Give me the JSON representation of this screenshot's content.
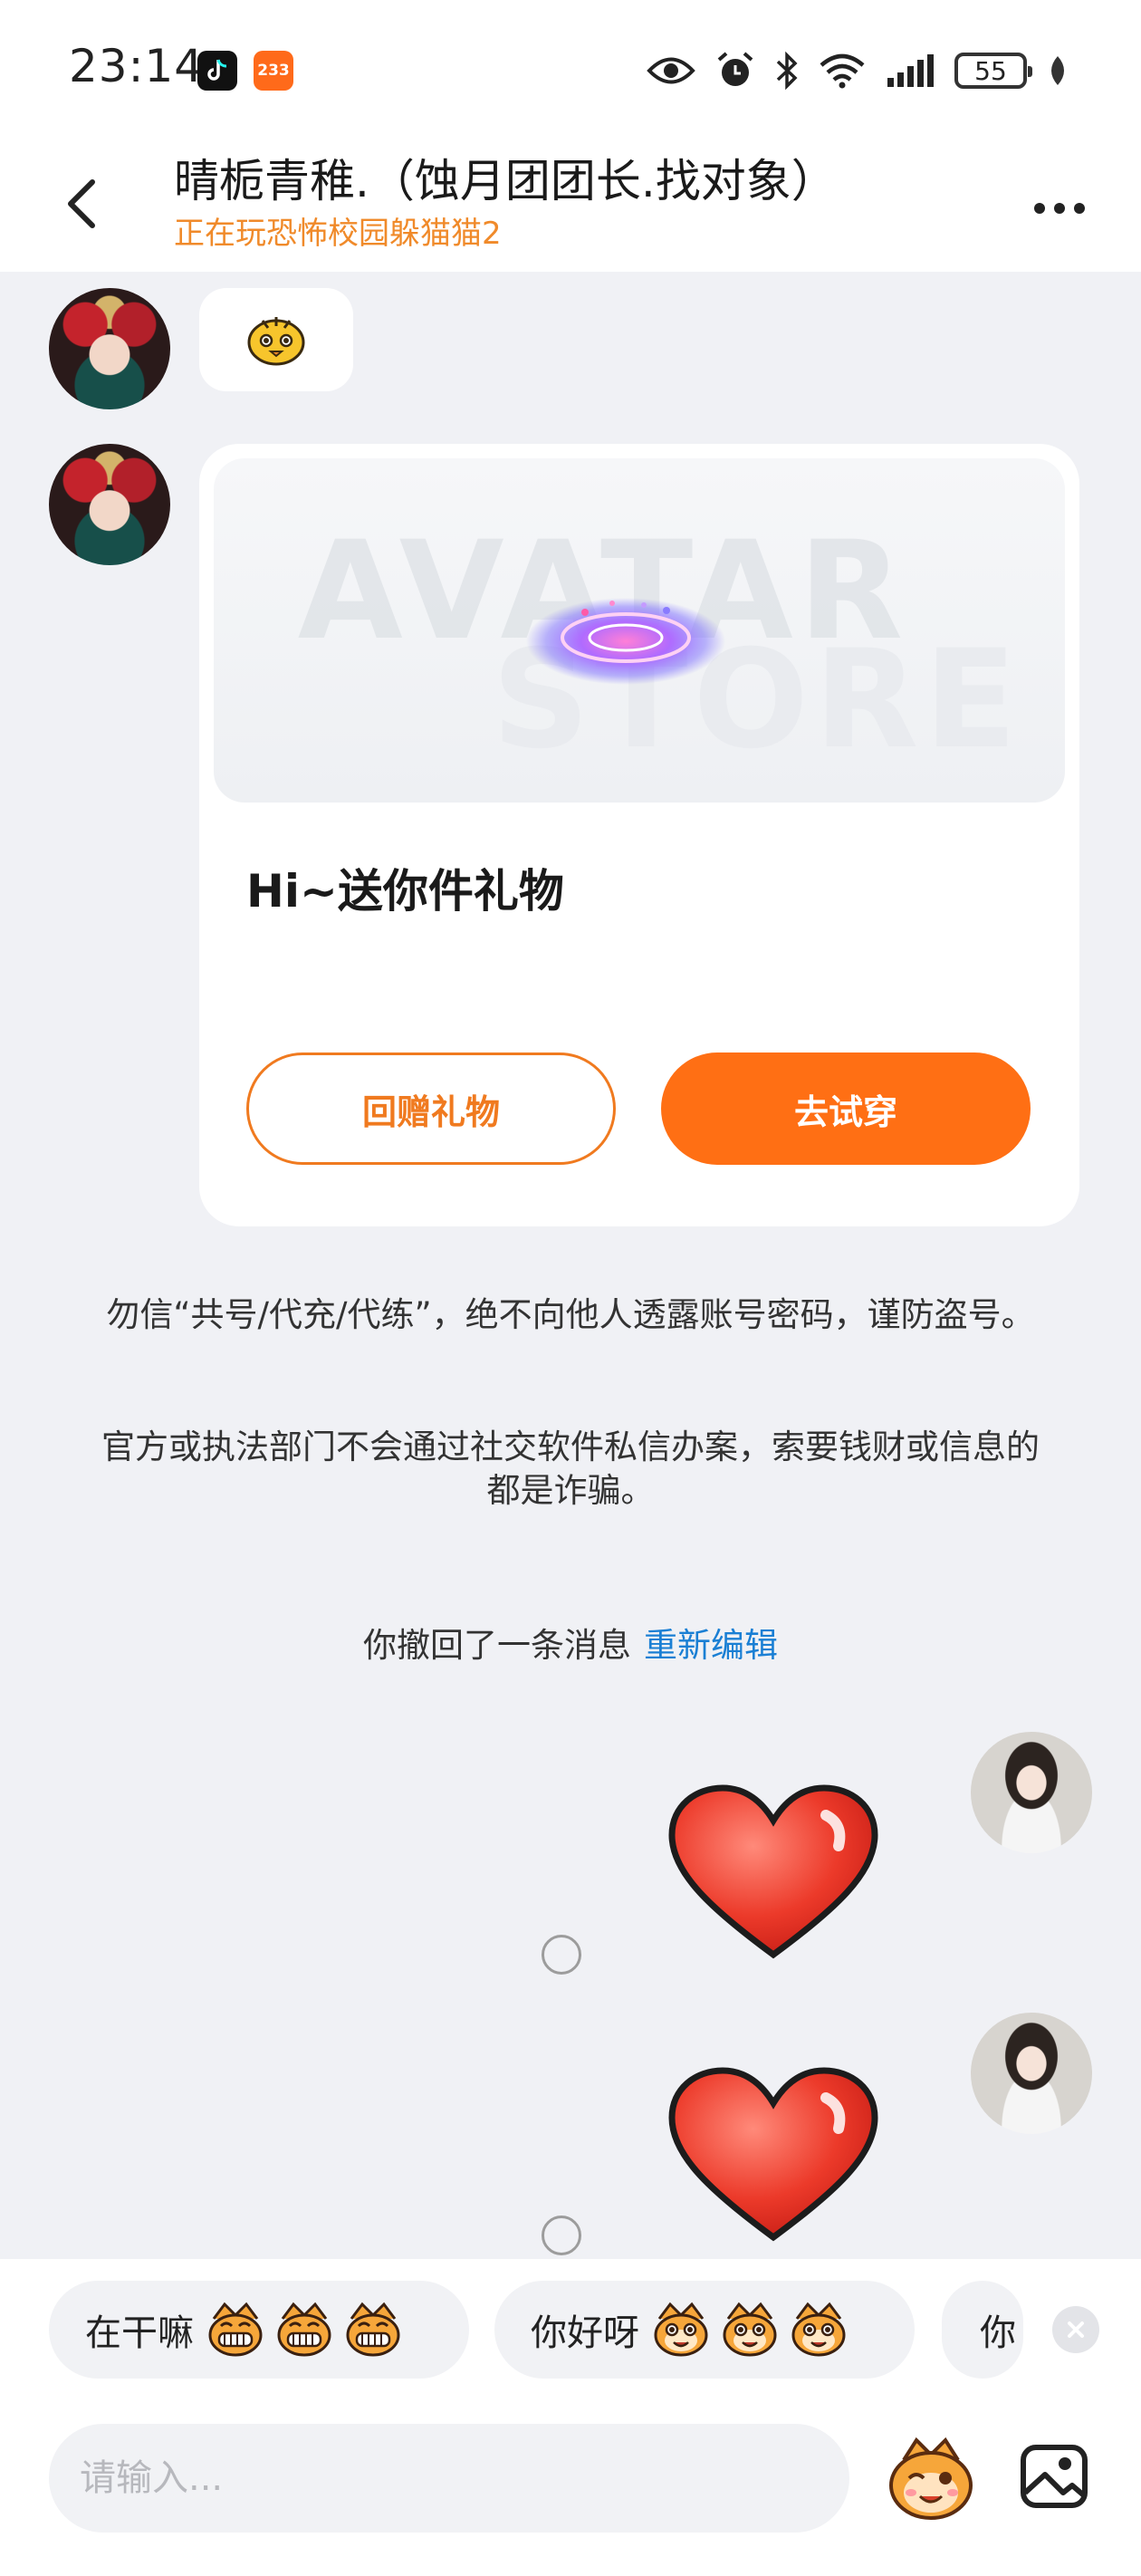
{
  "status_bar": {
    "time": "23:14",
    "badge_233": "233",
    "battery": "55"
  },
  "header": {
    "title": "晴栀青稚.（蚀月团团长.找对象）",
    "subtitle": "正在玩恐怖校园躲猫猫2"
  },
  "gift_card": {
    "banner_watermark_line1": "AVATAR",
    "banner_watermark_line2": "STORE",
    "message": "Hi~送你件礼物",
    "return_gift_label": "回赠礼物",
    "try_on_label": "去试穿"
  },
  "notices": {
    "line1": "勿信“共号/代充/代练”，绝不向他人透露账号密码，谨防盗号。",
    "line2": "官方或执法部门不会通过社交软件私信办案，索要钱财或信息的都是诈骗。"
  },
  "recall": {
    "text": "你撤回了一条消息",
    "edit_label": "重新编辑"
  },
  "quick_replies": [
    {
      "label": "在干嘛"
    },
    {
      "label": "你好呀"
    },
    {
      "label": "你"
    }
  ],
  "input": {
    "placeholder": "请输入..."
  },
  "colors": {
    "accent": "#ff6f14",
    "subtitle": "#f08a2a",
    "link": "#1a7fd4",
    "background": "#f0f1f5"
  },
  "icons": [
    "tiktok-icon",
    "eye-icon",
    "alarm-icon",
    "bluetooth-icon",
    "wifi-icon",
    "signal-icon",
    "leaf-icon",
    "back-icon",
    "more-icon",
    "heart-icon",
    "emoji-icon",
    "image-icon",
    "close-icon"
  ]
}
